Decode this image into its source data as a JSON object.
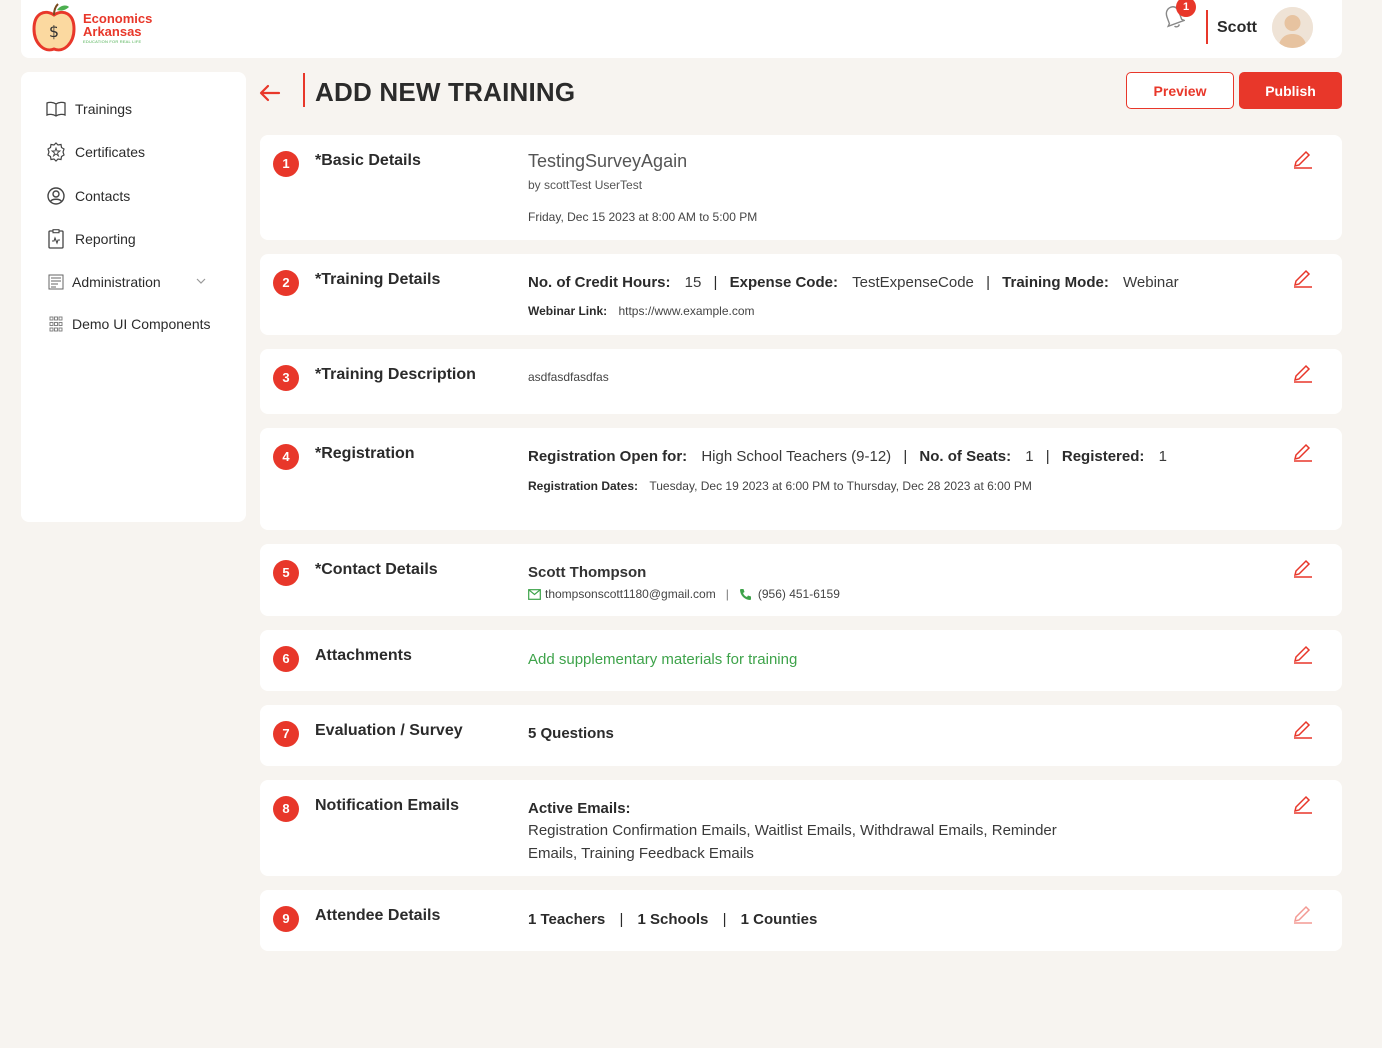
{
  "header": {
    "brand_line1": "Economics",
    "brand_line2": "Arkansas",
    "brand_tagline": "EDUCATION FOR REAL LIFE",
    "notification_count": "1",
    "username": "Scott"
  },
  "sidebar": {
    "items": [
      {
        "label": "Trainings",
        "icon": "book-icon"
      },
      {
        "label": "Certificates",
        "icon": "badge-icon"
      },
      {
        "label": "Contacts",
        "icon": "user-circle-icon"
      },
      {
        "label": "Reporting",
        "icon": "report-icon"
      },
      {
        "label": "Administration",
        "icon": "admin-icon"
      },
      {
        "label": "Demo UI Components",
        "icon": "grid-icon"
      }
    ]
  },
  "page": {
    "title": "ADD NEW TRAINING",
    "preview_label": "Preview",
    "publish_label": "Publish"
  },
  "sections": {
    "basic": {
      "num": "1",
      "title": "*Basic Details",
      "name": "TestingSurveyAgain",
      "by": "by scottTest UserTest",
      "date": "Friday, Dec 15 2023 at 8:00 AM to 5:00 PM"
    },
    "training": {
      "num": "2",
      "title": "*Training Details",
      "credit_label": "No. of Credit Hours:",
      "credit_value": "15",
      "expense_label": "Expense Code:",
      "expense_value": "TestExpenseCode",
      "mode_label": "Training Mode:",
      "mode_value": "Webinar",
      "webinar_label": "Webinar Link:",
      "webinar_value": "https://www.example.com"
    },
    "description": {
      "num": "3",
      "title": "*Training Description",
      "text": "asdfasdfasdfas"
    },
    "registration": {
      "num": "4",
      "title": "*Registration",
      "open_label": "Registration Open for:",
      "open_value": "High School Teachers (9-12)",
      "seats_label": "No. of Seats:",
      "seats_value": "1",
      "registered_label": "Registered:",
      "registered_value": "1",
      "dates_label": "Registration Dates:",
      "dates_value": "Tuesday, Dec 19 2023 at 6:00 PM to Thursday, Dec 28 2023 at 6:00 PM"
    },
    "contact": {
      "num": "5",
      "title": "*Contact Details",
      "name": "Scott Thompson",
      "email": "thompsonscott1180@gmail.com",
      "phone": "(956) 451-6159"
    },
    "attachments": {
      "num": "6",
      "title": "Attachments",
      "link": "Add supplementary materials for training"
    },
    "evaluation": {
      "num": "7",
      "title": "Evaluation / Survey",
      "questions": "5 Questions"
    },
    "notification": {
      "num": "8",
      "title": "Notification Emails",
      "label": "Active Emails:",
      "line1": "Registration Confirmation Emails, Waitlist Emails, Withdrawal Emails, Reminder",
      "line2": "Emails, Training Feedback Emails"
    },
    "attendee": {
      "num": "9",
      "title": "Attendee Details",
      "teachers": "1 Teachers",
      "schools": "1 Schools",
      "counties": "1 Counties"
    }
  },
  "colors": {
    "accent": "#e8372a",
    "link_green": "#3ea34a",
    "background": "#f7f4f0"
  }
}
